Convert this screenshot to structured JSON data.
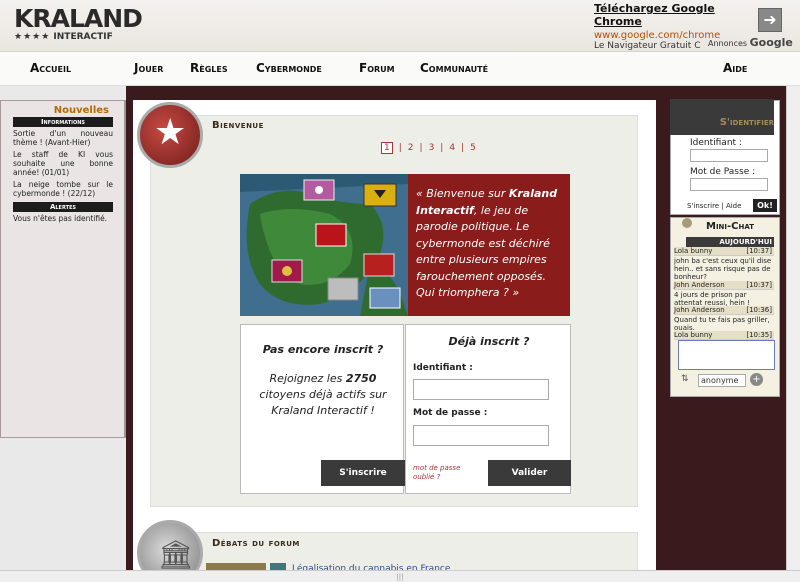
{
  "header": {
    "logo_top": "KRALAND",
    "logo_bottom": "INTERACTIF",
    "logo_stars": "★★★★"
  },
  "ad": {
    "title": "Téléchargez Google Chrome",
    "url": "www.google.com/chrome",
    "desc": "Le Navigateur Gratuit C",
    "annonces": "Annonces",
    "google": "Google"
  },
  "nav": {
    "accueil": "Accueil",
    "jouer": "Jouer",
    "regles": "Règles",
    "cybermonde": "Cybermonde",
    "forum": "Forum",
    "communaute": "Communauté",
    "aide": "Aide"
  },
  "left": {
    "title": "Nouvelles",
    "info_bar": "Informations",
    "news": [
      "Sortie d'un nouveau thème ! (Avant-Hier)",
      "Le staff de KI vous souhaite une bonne année! (01/01)",
      "La neige tombe sur le cybermonde ! (22/12)"
    ],
    "alert_bar": "Alertes",
    "alert_text": "Vous n'êtes pas identifié."
  },
  "main": {
    "welcome_title": "Bienvenue",
    "pages": [
      "1",
      "2",
      "3",
      "4",
      "5"
    ],
    "pager_sep": "|",
    "welcome_text_a": "« Bienvenue sur ",
    "welcome_text_b": "Kraland Interactif",
    "welcome_text_c": ", le jeu de parodie politique. Le cybermonde est déchiré entre plusieurs empires farouchement opposés. Qui triomphera ? »",
    "not_registered": "Pas encore inscrit ?",
    "join_a": "Rejoignez les ",
    "join_count": "2750",
    "join_b": " citoyens déjà actifs sur Kraland Interactif !",
    "signup_btn": "S'inscrire",
    "already": "Déjà inscrit ?",
    "id_label": "Identifiant :",
    "pw_label": "Mot de passe :",
    "forgot": "mot de passe oublié ?",
    "validate_btn": "Valider",
    "forum_title": "Débats du forum",
    "forum_item": "Légalisation du cannabis en France"
  },
  "right": {
    "login_title": "S'identifier",
    "id_label": "Identifiant :",
    "pw_label": "Mot de Passe :",
    "signup_link": "S'inscrire",
    "sep": "|",
    "help_link": "Aide",
    "ok_btn": "Ok!",
    "chat_title": "Mini-Chat",
    "chat_day": "AUJOURD'HUI",
    "chat": [
      {
        "text": "john ba c'est ceux qu'il dise hein.. et sans risque pas de bonheur?"
      },
      {
        "name": "John Anderson",
        "time": "[10:37]",
        "text": "4 jours de prison par attentat reussi, hein !"
      },
      {
        "name": "John Anderson",
        "time": "[10:36]",
        "text": "Quand tu te fais pas griller, ouais."
      },
      {
        "name": "Lola bunny",
        "time": "[10:35]"
      }
    ],
    "chat_first_name": "Lola bunny",
    "chat_first_time": "[10:37]",
    "nick": "anonyme"
  },
  "colors": {
    "accent_red": "#8a1c1c",
    "dark_frame": "#3a1a1c",
    "orange_title": "#b26b00"
  }
}
